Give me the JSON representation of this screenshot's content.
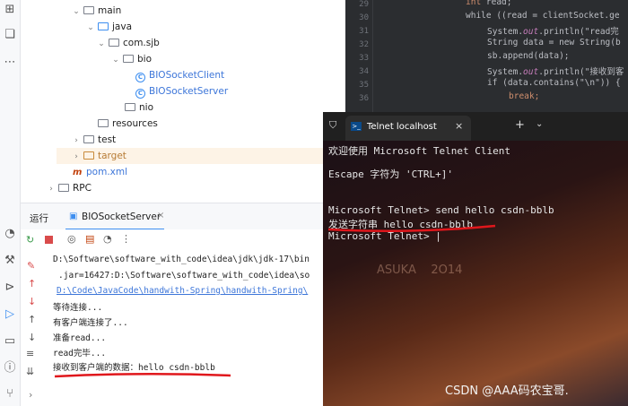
{
  "activity_bar": {
    "icons": [
      "apps-icon",
      "folder-icon",
      "bookmark-icon",
      "more-icon",
      "run-icon",
      "build-icon",
      "services-icon",
      "debug-icon",
      "terminal-icon",
      "problems-icon",
      "git-icon"
    ]
  },
  "tree": {
    "items": [
      {
        "label": "main"
      },
      {
        "label": "java"
      },
      {
        "label": "com.sjb"
      },
      {
        "label": "bio"
      },
      {
        "label": "BIOSocketClient"
      },
      {
        "label": "BIOSocketServer"
      },
      {
        "label": "nio"
      },
      {
        "label": "resources"
      },
      {
        "label": "test"
      },
      {
        "label": "target"
      },
      {
        "label": "pom.xml"
      },
      {
        "label": "RPC"
      }
    ]
  },
  "editor": {
    "line_numbers": [
      "29",
      "30",
      "31",
      "32",
      "33",
      "34",
      "35",
      "36"
    ],
    "lines": [
      [
        "int ",
        "read;"
      ],
      [
        "while ((read = clientSocket.ge"
      ],
      [
        "System.",
        "out",
        ".println(\"read完"
      ],
      [
        "String data = new String(b"
      ],
      [
        "sb.append(data);"
      ],
      [
        "System.",
        "out",
        ".println(\"接收到客"
      ],
      [
        "if (data.contains(\"\\n\")) {"
      ],
      [
        "break;"
      ]
    ]
  },
  "run_panel": {
    "tab_label": "运行",
    "config_label": "BIOSocketServer",
    "console_lines": [
      "D:\\Software\\software_with_code\\idea\\jdk\\jdk-17\\bin",
      ".jar=16427:D:\\Software\\software_with_code\\idea\\so",
      "D:\\Code\\JavaCode\\handwith-Spring\\handwith-Spring\\",
      "等待连接...",
      "有客户端连接了...",
      "准备read...",
      "read完毕...",
      "接收到客户端的数据：hello csdn-bblb"
    ]
  },
  "telnet": {
    "tab_title": "Telnet localhost",
    "lines": [
      "欢迎使用 Microsoft Telnet Client",
      "Escape 字符为 'CTRL+]'",
      "Microsoft Telnet> send hello csdn-bblb",
      "发送字符串 hello csdn-bblb",
      "Microsoft Telnet> |"
    ],
    "watermark_art": "ASUKA    2O14",
    "credit": "CSDN @AAA码农宝哥."
  },
  "colors": {
    "editor_bg": "#2b2d30",
    "terminal_bg": "#0c0c0c",
    "underline": "#e0171c"
  }
}
